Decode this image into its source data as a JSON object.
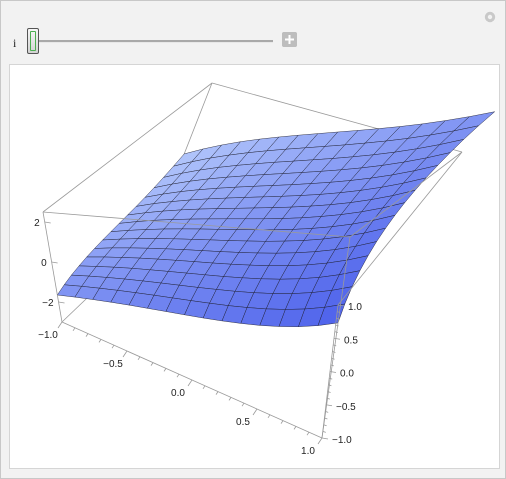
{
  "manipulate": {
    "control_variable": "i",
    "slider_value": 0
  },
  "icons": {
    "options": "gear-icon",
    "expand": "plus-icon"
  },
  "colors": {
    "surface": "#6f9ef5",
    "surface_dark": "#3a58e0",
    "surface_light": "#a9c7fb",
    "mesh": "#1b1b2a",
    "box": "#9a9a9a",
    "panel_bg": "#f2f2f2"
  },
  "chart_data": {
    "type": "surface3d",
    "title": "",
    "x_range": [
      -1,
      1
    ],
    "y_range": [
      -1,
      1
    ],
    "z_range": [
      -3,
      2.5
    ],
    "x_ticks": [
      {
        "v": -1.0,
        "label": "−1.0"
      },
      {
        "v": -0.5,
        "label": "−0.5"
      },
      {
        "v": 0.0,
        "label": "0.0"
      },
      {
        "v": 0.5,
        "label": "0.5"
      },
      {
        "v": 1.0,
        "label": "1.0"
      }
    ],
    "y_ticks": [
      {
        "v": -1.0,
        "label": "−1.0"
      },
      {
        "v": -0.5,
        "label": "−0.5"
      },
      {
        "v": 0.0,
        "label": "0.0"
      },
      {
        "v": 0.5,
        "label": "0.5"
      },
      {
        "v": 1.0,
        "label": "1.0"
      }
    ],
    "z_ticks": [
      {
        "v": 2,
        "label": "2"
      },
      {
        "v": 0,
        "label": "0"
      },
      {
        "v": -2,
        "label": "−2"
      }
    ],
    "mesh_lines": 15,
    "surface_samples": [
      {
        "x": -1,
        "y": -1,
        "z": -2.9
      },
      {
        "x": 1,
        "y": -1,
        "z": -2.4
      },
      {
        "x": -1,
        "y": 1,
        "z": -1.2
      },
      {
        "x": 1,
        "y": 1,
        "z": 2.6
      },
      {
        "x": 0,
        "y": 0,
        "z": 0.6
      }
    ]
  }
}
